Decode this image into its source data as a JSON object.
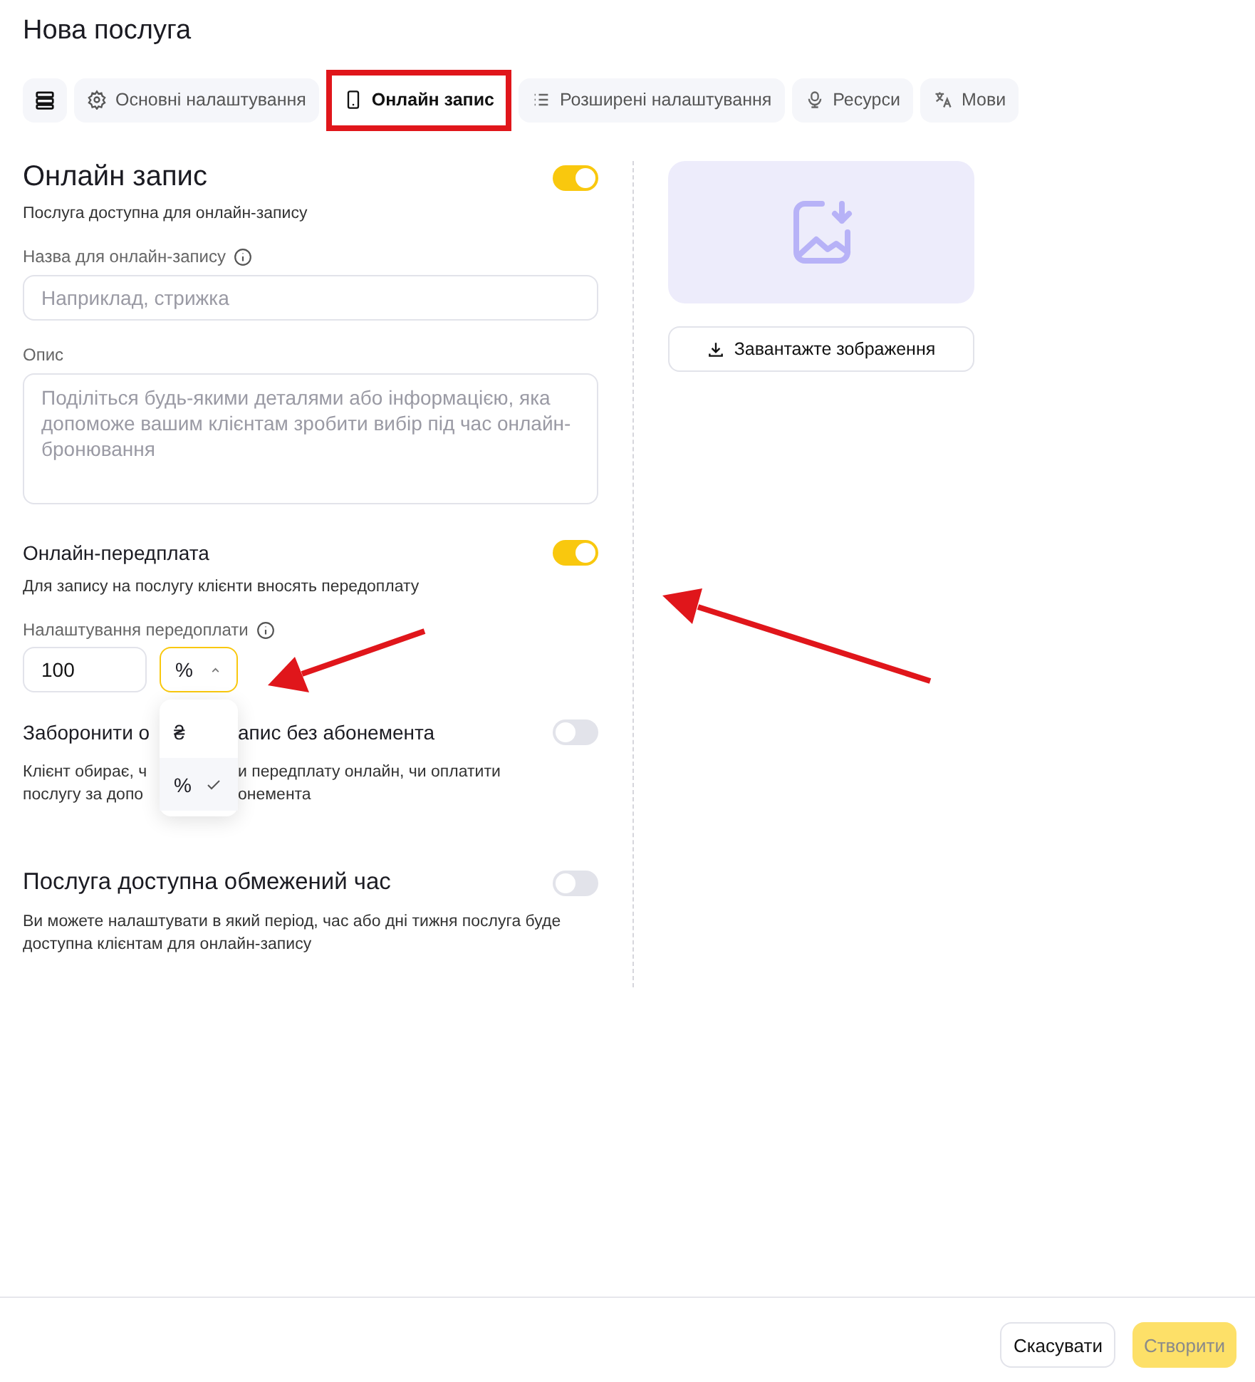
{
  "title": "Нова послуга",
  "tabs": [
    {
      "label": "Основні налаштування",
      "selected": false,
      "highlighted": false
    },
    {
      "label": "Онлайн запис",
      "selected": true,
      "highlighted": true
    },
    {
      "label": "Розширені налаштування",
      "selected": false,
      "highlighted": false
    },
    {
      "label": "Ресурси",
      "selected": false,
      "highlighted": false
    },
    {
      "label": "Мови",
      "selected": false,
      "highlighted": false
    }
  ],
  "online_booking": {
    "title": "Онлайн запис",
    "on": true,
    "description": "Послуга доступна для онлайн-запису",
    "name_field": {
      "label": "Назва для онлайн-запису",
      "placeholder": "Наприклад, стрижка"
    },
    "description_field": {
      "label": "Опис",
      "placeholder": "Поділіться будь-якими деталями або інформацією, яка допоможе вашим клієнтам зробити вибір під час онлайн-бронювання"
    }
  },
  "prepayment": {
    "title": "Онлайн-передплата",
    "on": true,
    "description": "Для запису на послугу клієнти вносять передоплату",
    "settings_label": "Налаштування передоплати",
    "amount": "100",
    "unit": "%",
    "unit_open": true,
    "unit_options": [
      {
        "label": "₴",
        "selected": false
      },
      {
        "label": "%",
        "selected": true
      }
    ]
  },
  "no_subscription": {
    "title_parts": [
      "Заборонити о",
      "апис без абонемента"
    ],
    "on": false,
    "description_lines": [
      [
        "Клієнт обирає, ч",
        "и передплату онлайн, чи оплатити"
      ],
      [
        "послугу за допо",
        "онемента"
      ]
    ]
  },
  "limited_time": {
    "title": "Послуга доступна обмежений час",
    "on": false,
    "description": "Ви можете налаштувати в який період, час або дні тижня послуга буде доступна клієнтам для онлайн-запису"
  },
  "image": {
    "upload_button": "Завантажте зображення"
  },
  "footer": {
    "cancel": "Скасувати",
    "create": {
      "label": "Створити",
      "disabled": true
    }
  }
}
